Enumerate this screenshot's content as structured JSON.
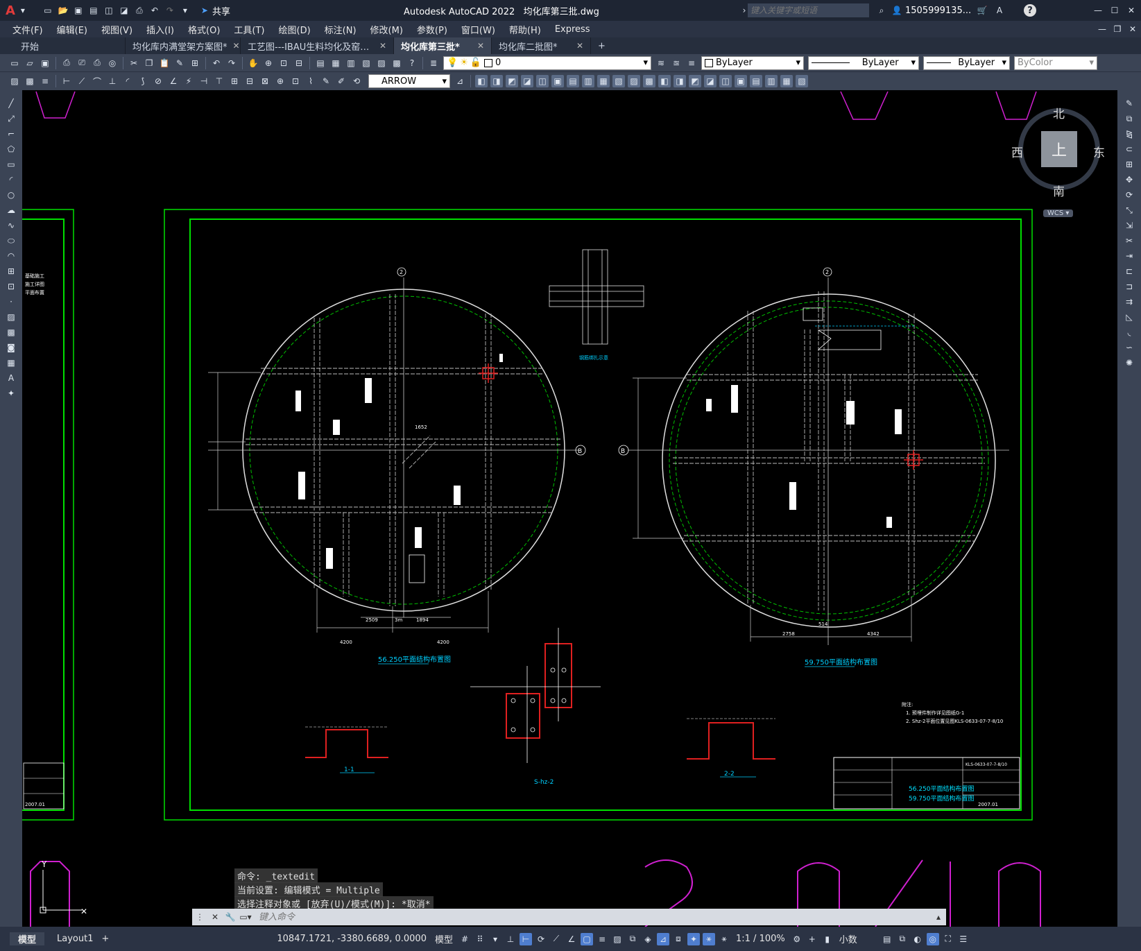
{
  "app": {
    "title": "Autodesk AutoCAD 2022",
    "file": "均化库第三批.dwg",
    "share": "共享",
    "search_placeholder": "键入关键字或短语",
    "user": "1505999135...",
    "help": "?"
  },
  "menu": [
    "文件(F)",
    "编辑(E)",
    "视图(V)",
    "插入(I)",
    "格式(O)",
    "工具(T)",
    "绘图(D)",
    "标注(N)",
    "修改(M)",
    "参数(P)",
    "窗口(W)",
    "帮助(H)",
    "Express"
  ],
  "tabs": [
    {
      "label": "开始",
      "active": false,
      "closable": false
    },
    {
      "label": "均化库内满堂架方案图*",
      "active": false,
      "closable": true
    },
    {
      "label": "工艺图---IBAU生料均化及窑尾喂料",
      "active": false,
      "closable": true
    },
    {
      "label": "均化库第三批*",
      "active": true,
      "closable": true
    },
    {
      "label": "均化库二批图*",
      "active": false,
      "closable": true
    }
  ],
  "toolbar": {
    "layer": "0",
    "color": "ByLayer",
    "linetype": "ByLayer",
    "lineweight": "ByLayer",
    "plotstyle": "ByColor",
    "dimstyle": "ARROW"
  },
  "viewcube": {
    "north": "北",
    "south": "南",
    "east": "东",
    "west": "西",
    "top": "上",
    "wcs": "WCS"
  },
  "drawing": {
    "left_title": "56.250平面结构布置图",
    "right_title": "59.750平面结构布置图",
    "section1": "1-1",
    "section2": "2-2",
    "detail": "S-hz-2",
    "axis_b": "B",
    "axis_2": "2",
    "dims_left": [
      "4200",
      "2509",
      "1894",
      "4200",
      "3m",
      "1652"
    ],
    "dims_right": [
      "2758",
      "4342",
      "514"
    ],
    "notes_head": "附注:",
    "notes": [
      "1. 预埋件制作详见图纸G-1",
      "2. Shz-2平面位置见图KLS-0633-07-7-8/10"
    ],
    "title_block": {
      "name1": "56.250平面结构布置图",
      "name2": "59.750平面结构布置图",
      "drawing_no": "KLS-0633-07-7-8/10",
      "date": "2007.01"
    }
  },
  "command": {
    "history": [
      "命令: _textedit",
      "当前设置: 编辑模式 = Multiple",
      "选择注释对象或 [放弃(U)/模式(M)]: *取消*"
    ],
    "placeholder": "键入命令"
  },
  "layouts": [
    "模型",
    "Layout1",
    "+"
  ],
  "status": {
    "coords": "10847.1721, -3380.6689, 0.0000",
    "space": "模型",
    "scale": "1:1 / 100%",
    "units": "小数"
  }
}
